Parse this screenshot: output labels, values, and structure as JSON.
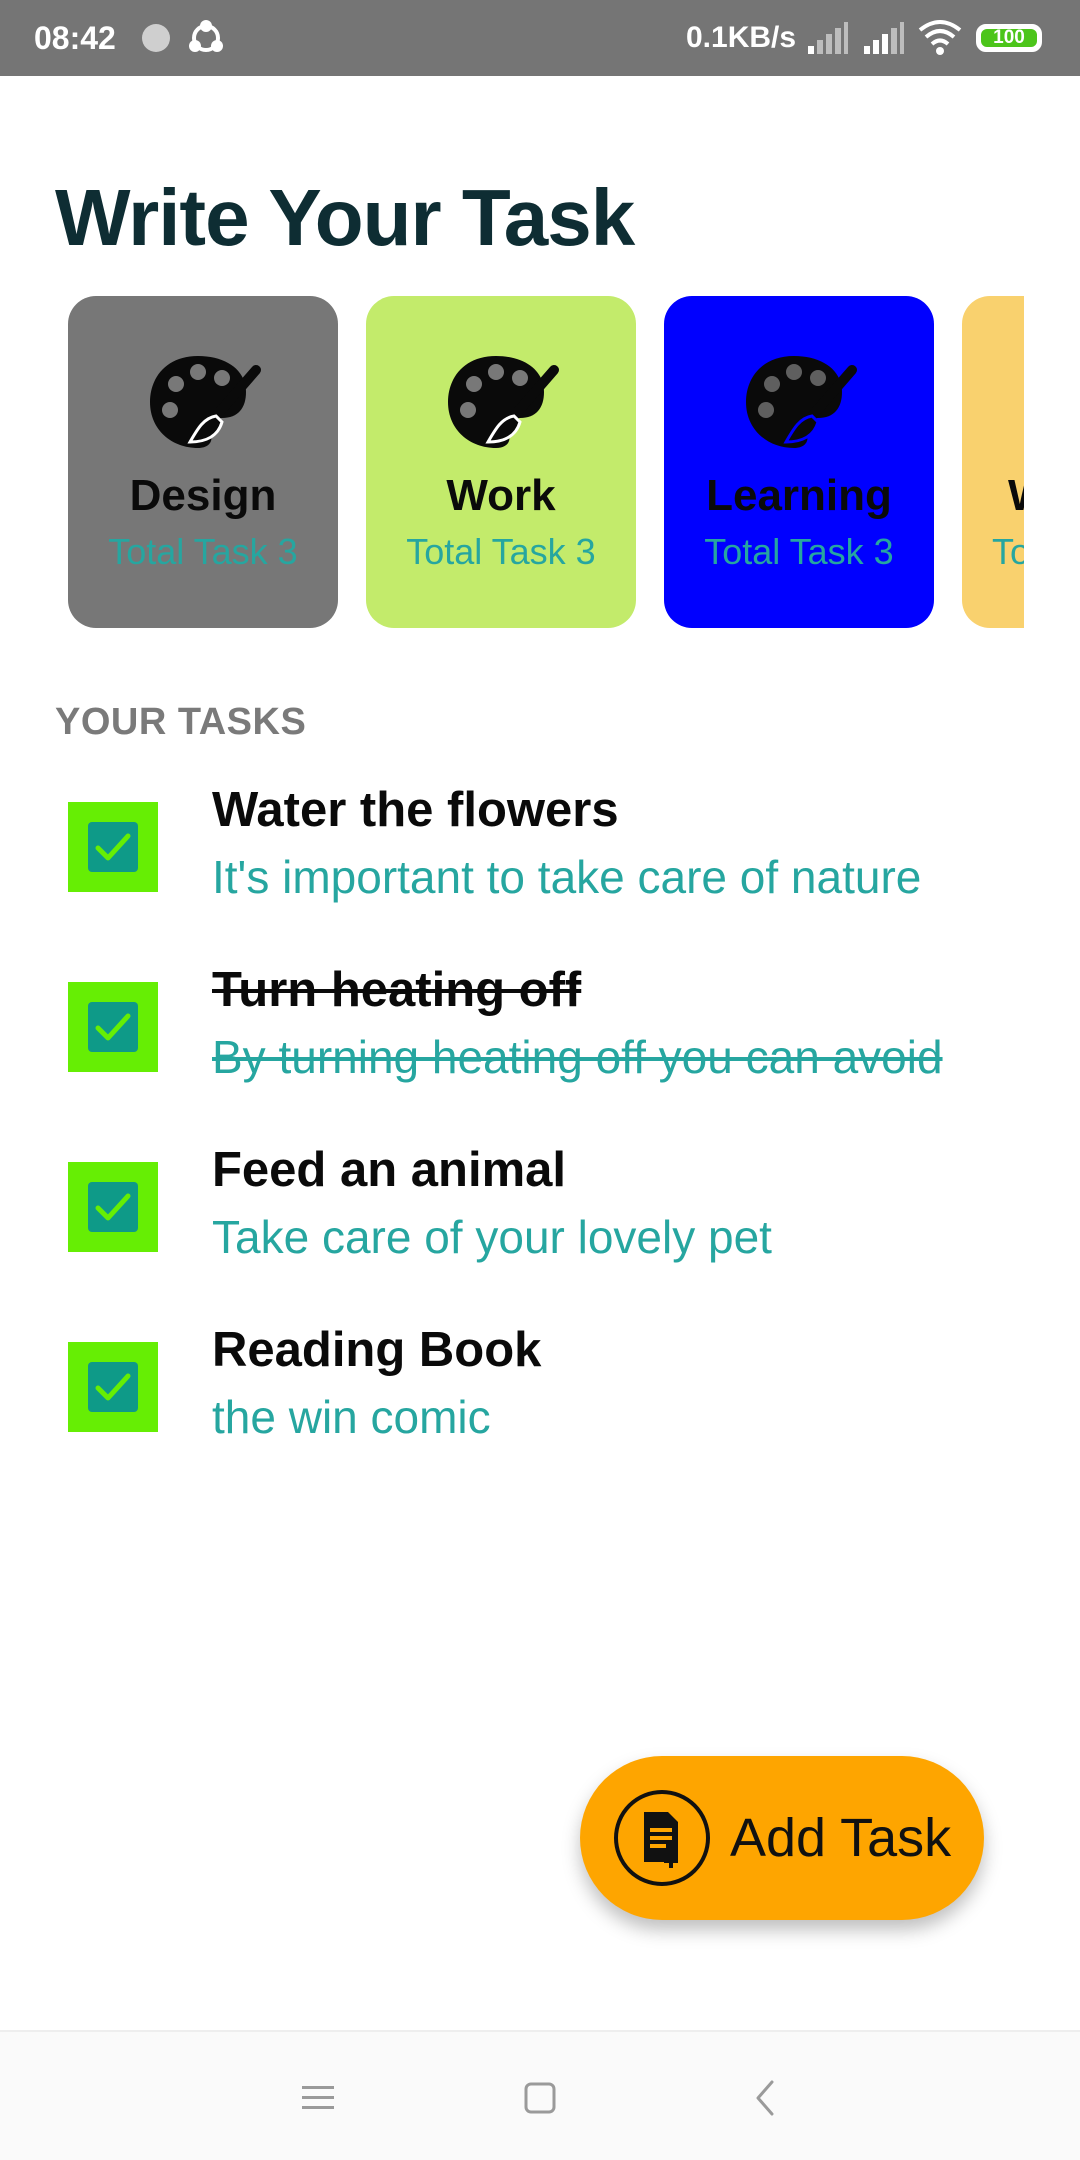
{
  "status_bar": {
    "time": "08:42",
    "network_speed": "0.1KB/s",
    "battery": "100",
    "battery_level": 1.0
  },
  "page": {
    "title": "Write Your Task"
  },
  "categories": [
    {
      "name": "Design",
      "count_label": "Total Task 3",
      "color": "#777777",
      "icon": "palette-icon"
    },
    {
      "name": "Work",
      "count_label": "Total Task 3",
      "color": "#c3eb6b",
      "icon": "palette-icon"
    },
    {
      "name": "Learning",
      "count_label": "Total Task 3",
      "color": "#0000ff",
      "icon": "palette-icon"
    },
    {
      "name": "W",
      "count_label": "To",
      "color": "#f9d16e",
      "icon": "palette-icon"
    }
  ],
  "tasks_section": {
    "label": "YOUR TASKS"
  },
  "tasks": [
    {
      "title": "Water the flowers",
      "description": "It's important to take care of nature",
      "checked": true,
      "strikethrough": false
    },
    {
      "title": "Turn heating off",
      "description": "By turning heating off you can avoid",
      "checked": true,
      "strikethrough": true
    },
    {
      "title": "Feed an animal",
      "description": "Take care of your lovely pet",
      "checked": true,
      "strikethrough": false
    },
    {
      "title": "Reading Book",
      "description": "the win comic",
      "checked": true,
      "strikethrough": false
    }
  ],
  "fab": {
    "label": "Add Task",
    "icon": "add-document-icon",
    "color": "#fea500"
  },
  "nav_bar": {
    "icons": [
      "menu-icon",
      "home-square-icon",
      "back-chevron-icon"
    ]
  },
  "colors": {
    "title": "#0e2d33",
    "accent_teal": "#26a6a0",
    "checkbox_green": "#66ee04",
    "checkbox_teal": "#0e9a88"
  }
}
